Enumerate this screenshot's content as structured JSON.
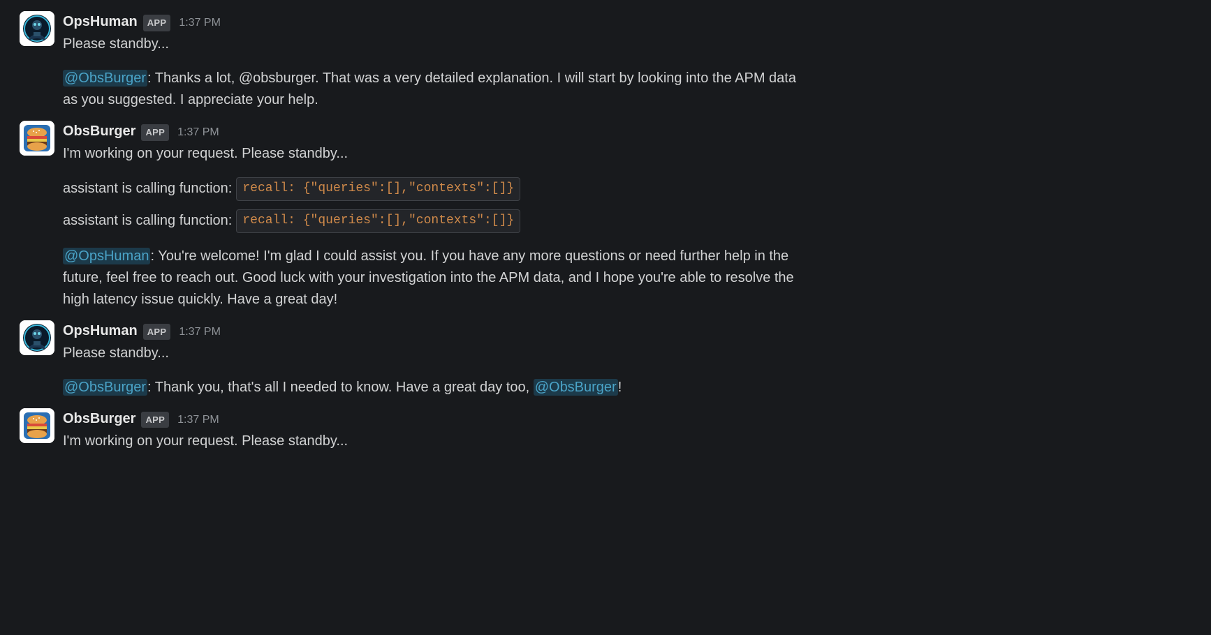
{
  "app_badge": "APP",
  "messages": [
    {
      "user": "OpsHuman",
      "avatar": "opshuman",
      "time": "1:37 PM",
      "lines": [
        {
          "type": "text",
          "content": "Please standby..."
        },
        {
          "type": "spacer"
        },
        {
          "type": "rich",
          "parts": [
            {
              "t": "mention",
              "v": "@ObsBurger"
            },
            {
              "t": "text",
              "v": ": Thanks a lot, @obsburger. That was a very detailed explanation. I will start by looking into the APM data as you suggested. I appreciate your help."
            }
          ]
        }
      ]
    },
    {
      "user": "ObsBurger",
      "avatar": "obsburger",
      "time": "1:37 PM",
      "lines": [
        {
          "type": "text",
          "content": "I'm working on your request. Please standby..."
        },
        {
          "type": "spacer"
        },
        {
          "type": "func",
          "prefix": "assistant is calling function: ",
          "code": "recall: {\"queries\":[],\"contexts\":[]}"
        },
        {
          "type": "spacer-sm"
        },
        {
          "type": "func",
          "prefix": "assistant is calling function: ",
          "code": "recall: {\"queries\":[],\"contexts\":[]}"
        },
        {
          "type": "spacer"
        },
        {
          "type": "rich",
          "parts": [
            {
              "t": "mention",
              "v": "@OpsHuman"
            },
            {
              "t": "text",
              "v": ": You're welcome! I'm glad I could assist you. If you have any more questions or need further help in the future, feel free to reach out. Good luck with your investigation into the APM data, and I hope you're able to resolve the high latency issue quickly. Have a great day!"
            }
          ]
        }
      ]
    },
    {
      "user": "OpsHuman",
      "avatar": "opshuman",
      "time": "1:37 PM",
      "lines": [
        {
          "type": "text",
          "content": "Please standby..."
        },
        {
          "type": "spacer"
        },
        {
          "type": "rich",
          "parts": [
            {
              "t": "mention",
              "v": "@ObsBurger"
            },
            {
              "t": "text",
              "v": ": Thank you, that's all I needed to know. Have a great day too, "
            },
            {
              "t": "mention",
              "v": "@ObsBurger"
            },
            {
              "t": "text",
              "v": "!"
            }
          ]
        }
      ]
    },
    {
      "user": "ObsBurger",
      "avatar": "obsburger",
      "time": "1:37 PM",
      "lines": [
        {
          "type": "text",
          "content": "I'm working on your request. Please standby..."
        }
      ]
    }
  ]
}
